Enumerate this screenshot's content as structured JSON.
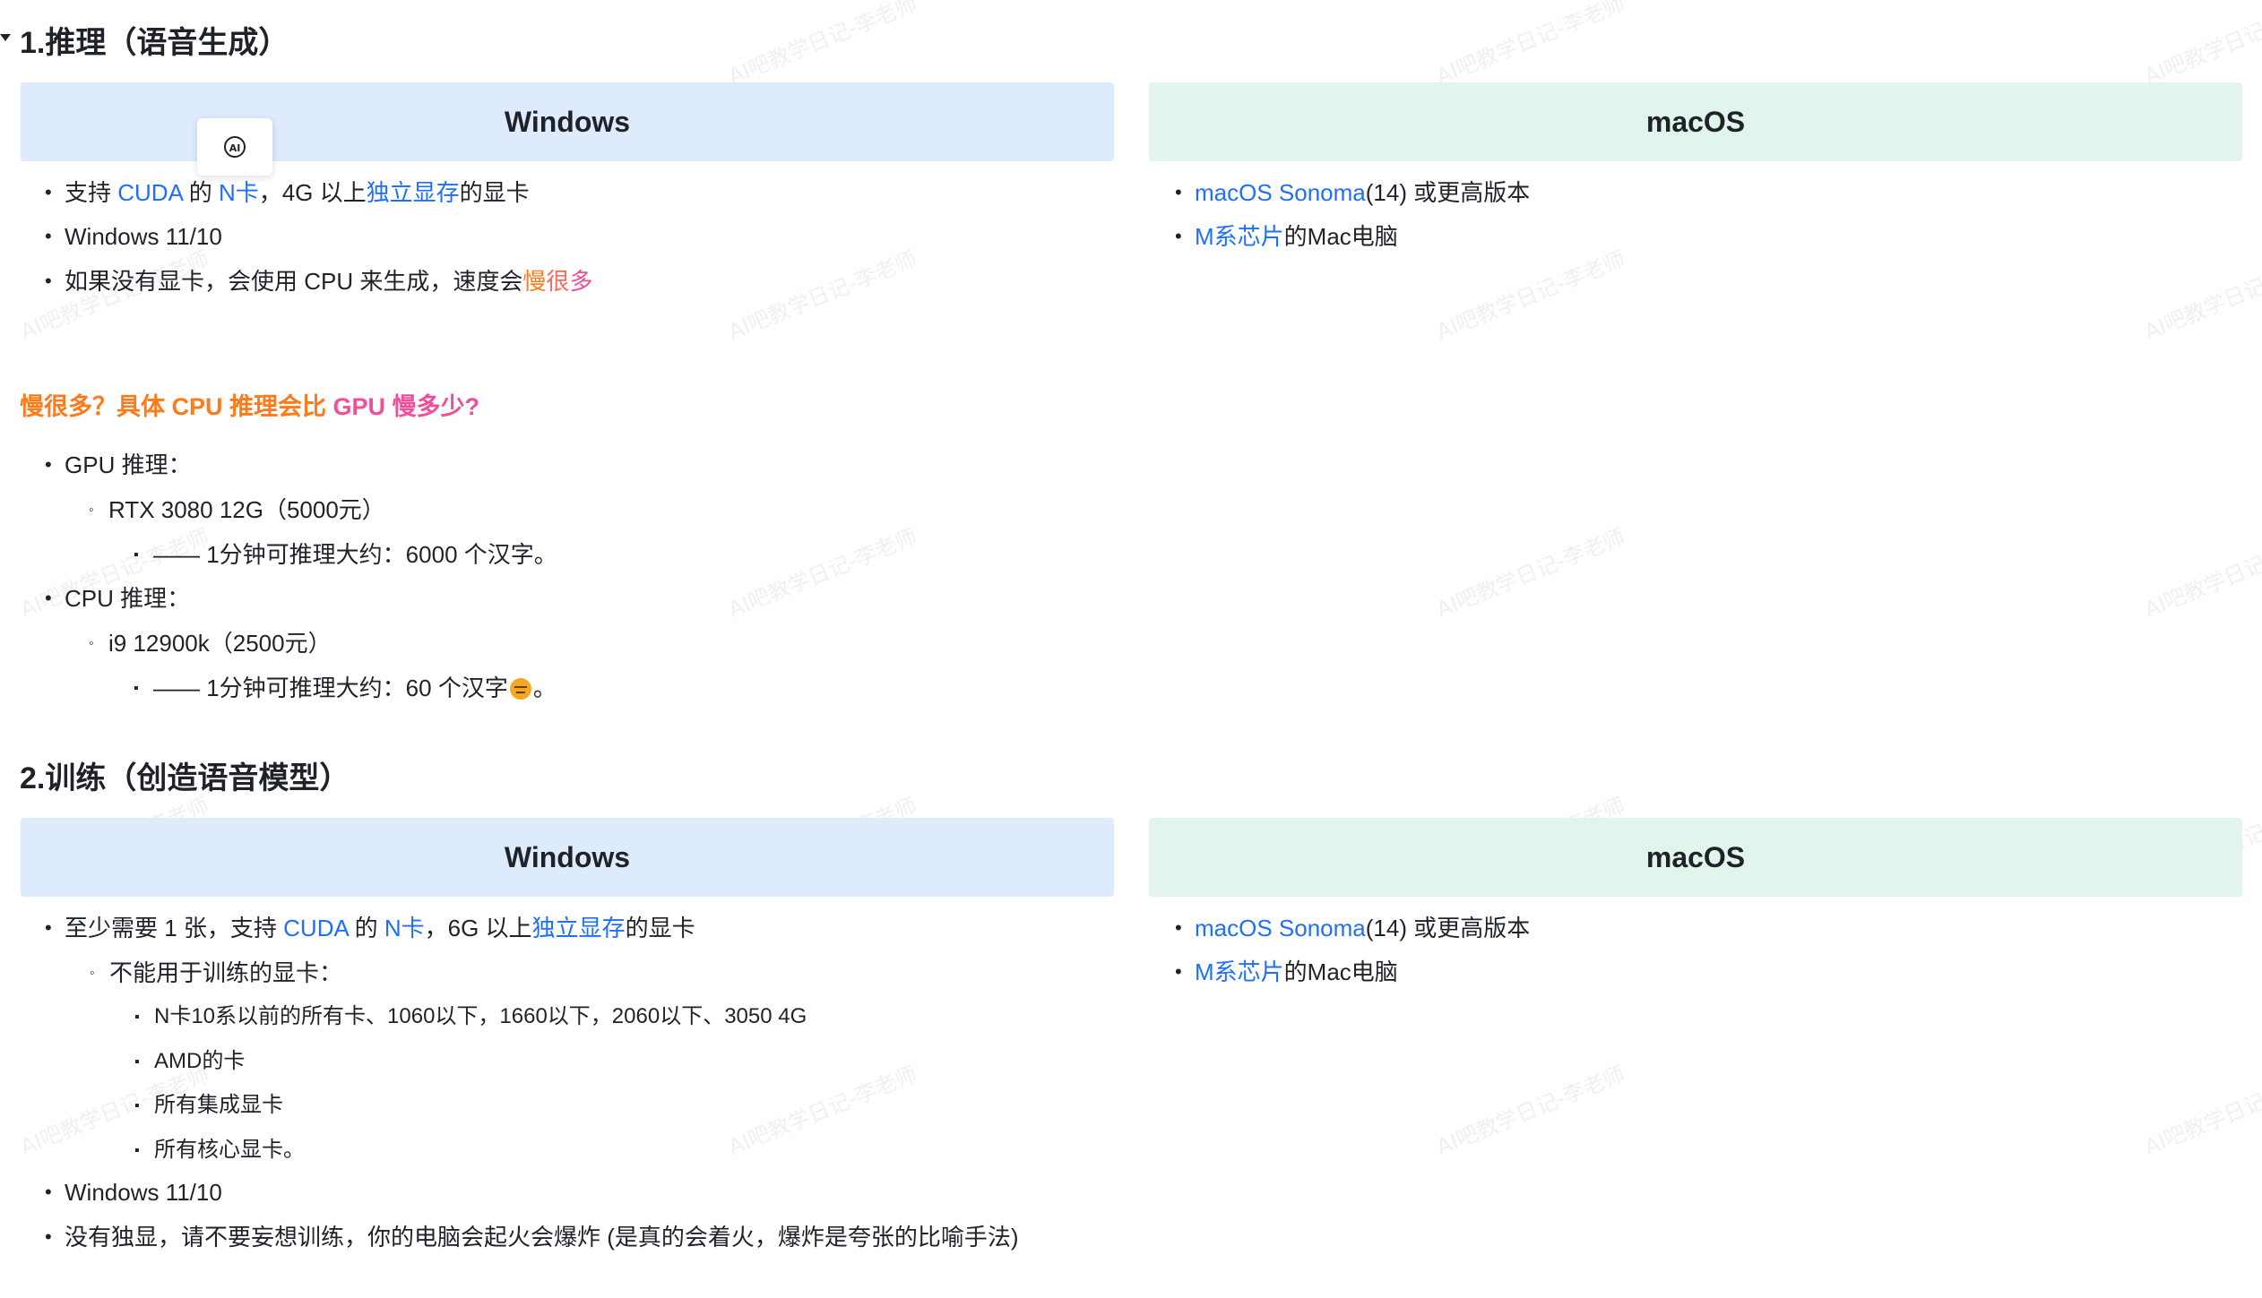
{
  "watermark": {
    "text": "AI吧教学日记-李老师"
  },
  "icons": {
    "toggle": "triangle-down-icon",
    "ai_badge": "ai-circle-icon",
    "emoji": "expressionless-face-emoji"
  },
  "section1": {
    "title": "1.推理（语音生成）",
    "windows_header": "Windows",
    "mac_header": "macOS",
    "windows_items": [
      {
        "p1": "支持 ",
        "l1": "CUDA",
        "p2": " 的 ",
        "l2": "N卡",
        "p3": "，4G 以上",
        "l3": "独立显存",
        "p4": "的显卡"
      },
      {
        "text": "Windows 11/10"
      },
      {
        "p1": "如果没有显卡，会使用 CPU 来生成，速度会",
        "slow1": "慢",
        "slow2": "很",
        "slow3": "多"
      }
    ],
    "mac_items": [
      {
        "link": "macOS Sonoma",
        "rest": "(14) 或更高版本"
      },
      {
        "link": "M系芯片",
        "rest": "的Mac电脑"
      }
    ]
  },
  "question": {
    "orange": "慢很多？具体 CPU 推理会比",
    "pink": " GPU 慢多少?"
  },
  "perf": {
    "gpu_label": "GPU 推理：",
    "gpu_card": "RTX 3080 12G（5000元）",
    "gpu_speed": "—— 1分钟可推理大约：6000 个汉字。",
    "cpu_label": "CPU 推理：",
    "cpu_chip": "i9 12900k（2500元）",
    "cpu_speed_a": "—— 1分钟可推理大约：60 个汉字",
    "cpu_speed_b": "。"
  },
  "section2": {
    "title": "2.训练（创造语音模型）",
    "windows_header": "Windows",
    "mac_header": "macOS",
    "windows_req": {
      "p1": "至少需要 1 张，支持 ",
      "l1": "CUDA",
      "p2": " 的 ",
      "l2": "N卡",
      "p3": "，6G 以上",
      "l3": "独立显存",
      "p4": "的显卡"
    },
    "unsupported_label": "不能用于训练的显卡：",
    "unsupported_list": [
      "N卡10系以前的所有卡、1060以下，1660以下，2060以下、3050 4G",
      "AMD的卡",
      "所有集成显卡",
      "所有核心显卡。"
    ],
    "os": "Windows 11/10",
    "warning": "没有独显，请不要妄想训练，你的电脑会起火会爆炸 (是真的会着火，爆炸是夸张的比喻手法)",
    "mac_items": [
      {
        "link": "macOS Sonoma",
        "rest": "(14) 或更高版本"
      },
      {
        "link": "M系芯片",
        "rest": "的Mac电脑"
      }
    ]
  }
}
